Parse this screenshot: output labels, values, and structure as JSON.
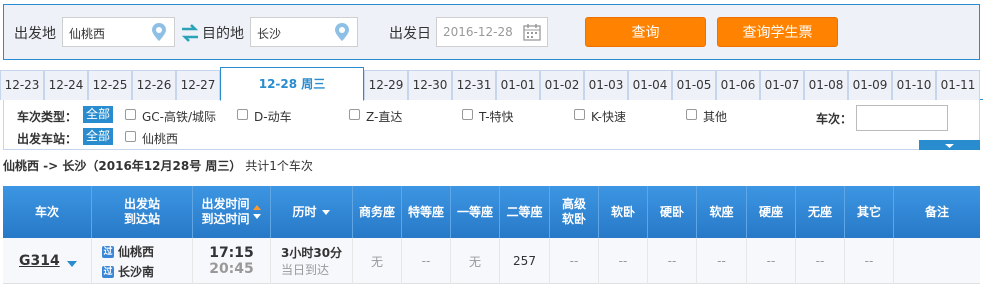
{
  "search": {
    "from_label": "出发地",
    "from_value": "仙桃西",
    "to_label": "目的地",
    "to_value": "长沙",
    "date_label": "出发日",
    "date_value": "2016-12-28",
    "query_button": "查询",
    "student_button": "查询学生票"
  },
  "dates": [
    {
      "label": "12-23"
    },
    {
      "label": "12-24"
    },
    {
      "label": "12-25"
    },
    {
      "label": "12-26"
    },
    {
      "label": "12-27"
    },
    {
      "label": "12-28 周三"
    },
    {
      "label": "12-29"
    },
    {
      "label": "12-30"
    },
    {
      "label": "12-31"
    },
    {
      "label": "01-01"
    },
    {
      "label": "01-02"
    },
    {
      "label": "01-03"
    },
    {
      "label": "01-04"
    },
    {
      "label": "01-05"
    },
    {
      "label": "01-06"
    },
    {
      "label": "01-07"
    },
    {
      "label": "01-08"
    },
    {
      "label": "01-09"
    },
    {
      "label": "01-10"
    },
    {
      "label": "01-11"
    }
  ],
  "filters": {
    "type_label": "车次类型：",
    "all_label": "全部",
    "types": [
      "GC-高铁/城际",
      "D-动车",
      "Z-直达",
      "T-特快",
      "K-快速",
      "其他"
    ],
    "station_label": "出发车站：",
    "station_all": "全部",
    "stations": [
      "仙桃西"
    ],
    "train_no_label": "车次："
  },
  "summary": {
    "route": "仙桃西 -> 长沙（2016年12月28号  周三）",
    "count": "共计1个车次"
  },
  "table": {
    "headers": {
      "train": "车次",
      "station_1": "出发站",
      "station_2": "到达站",
      "time_1": "出发时间",
      "time_2": "到达时间",
      "duration": "历时",
      "business": "商务座",
      "premium": "特等座",
      "first": "一等座",
      "second": "二等座",
      "soft_sleeper_hi_1": "高级",
      "soft_sleeper_hi_2": "软卧",
      "soft_sleeper": "软卧",
      "hard_sleeper": "硬卧",
      "soft_seat": "软座",
      "hard_seat": "硬座",
      "no_seat": "无座",
      "other": "其它",
      "remark": "备注"
    },
    "rows": [
      {
        "train": "G314",
        "from_icon": "过",
        "from": "仙桃西",
        "to_icon": "过",
        "to": "长沙南",
        "depart": "17:15",
        "arrive": "20:45",
        "duration": "3小时30分",
        "arrive_day": "当日到达",
        "business": "无",
        "premium": "--",
        "first": "无",
        "second": "257",
        "soft_sleeper_hi": "--",
        "soft_sleeper": "--",
        "hard_sleeper": "--",
        "soft_seat": "--",
        "hard_seat": "--",
        "no_seat": "--",
        "other": "--"
      }
    ]
  },
  "colors": {
    "brand_blue": "#298cce",
    "button_orange": "#ff8201"
  }
}
